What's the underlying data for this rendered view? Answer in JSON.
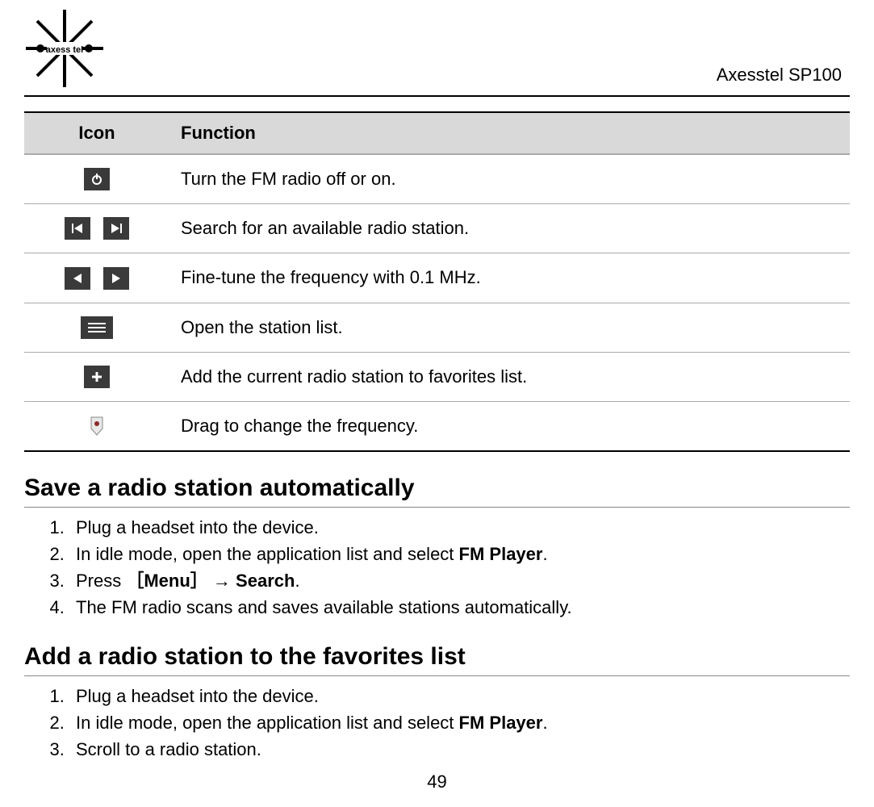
{
  "header": {
    "brand": "axess tel",
    "product": "Axesstel SP100"
  },
  "table": {
    "col_icon": "Icon",
    "col_func": "Function",
    "rows": [
      {
        "func": "Turn the FM radio off or on."
      },
      {
        "func": "Search for an available radio station."
      },
      {
        "func": "Fine-tune the frequency with 0.1 MHz."
      },
      {
        "func": "Open the station list."
      },
      {
        "func": "Add the current radio station to favorites list."
      },
      {
        "func": "Drag to change the frequency."
      }
    ]
  },
  "section1": {
    "heading": "Save a radio station automatically",
    "s1": "Plug a headset into the device.",
    "s2a": "In idle mode, open the application list and select ",
    "s2b": "FM Player",
    "s2c": ".",
    "s3a": "Press ",
    "s3b": "［Menu］",
    "s3c": " → ",
    "s3d": "Search",
    "s3e": ".",
    "s4": "The FM radio scans and saves available stations automatically."
  },
  "section2": {
    "heading": "Add a radio station to the favorites list",
    "s1": "Plug a headset into the device.",
    "s2a": "In idle mode, open the application list and select ",
    "s2b": "FM Player",
    "s2c": ".",
    "s3": "Scroll to a radio station."
  },
  "page_number": "49"
}
